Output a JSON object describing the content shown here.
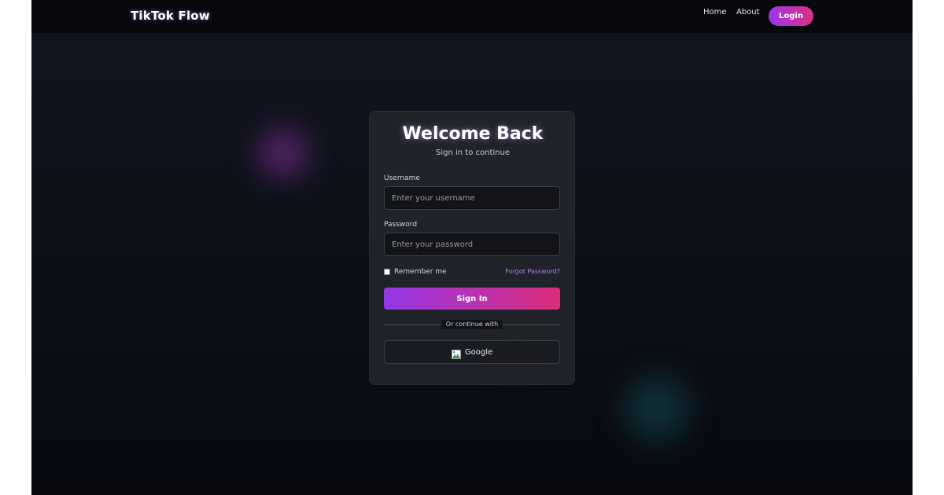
{
  "nav": {
    "brand": "TikTok Flow",
    "links": [
      "Home",
      "About"
    ],
    "login_label": "Login"
  },
  "card": {
    "title": "Welcome Back",
    "subtitle": "Sign in to continue",
    "username": {
      "label": "Username",
      "placeholder": "Enter your username",
      "value": ""
    },
    "password": {
      "label": "Password",
      "placeholder": "Enter your password",
      "value": ""
    },
    "remember_label": "Remember me",
    "remember_checked": false,
    "forgot_label": "Forgot Password?",
    "sign_in_label": "Sign In",
    "divider_text": "Or continue with",
    "google_label": "Google",
    "google_icon": "broken-image-icon"
  },
  "colors": {
    "accent_start": "#9537e8",
    "accent_end": "#dc2d7a",
    "link": "#b77be8",
    "background": "#0d1019",
    "card": "#22242b"
  }
}
